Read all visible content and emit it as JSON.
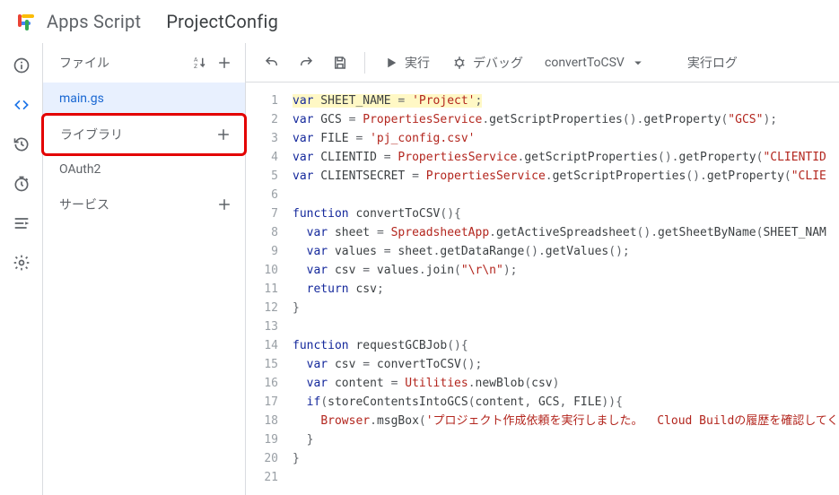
{
  "header": {
    "brand": "Apps Script",
    "project": "ProjectConfig"
  },
  "rail": {
    "items": [
      {
        "id": "overview-icon"
      },
      {
        "id": "editor-icon"
      },
      {
        "id": "history-icon"
      },
      {
        "id": "triggers-icon"
      },
      {
        "id": "executions-icon"
      },
      {
        "id": "settings-icon"
      }
    ]
  },
  "sidebar": {
    "files_label": "ファイル",
    "files": [
      {
        "name": "main.gs"
      }
    ],
    "libraries_label": "ライブラリ",
    "libraries": [
      {
        "name": "OAuth2"
      }
    ],
    "services_label": "サービス"
  },
  "toolbar": {
    "run": "実行",
    "debug": "デバッグ",
    "fn_selected": "convertToCSV",
    "log": "実行ログ"
  },
  "code": {
    "tokens": [
      [
        [
          "k",
          "var"
        ],
        [
          "pn",
          " SHEET_NAME "
        ],
        [
          "p",
          "="
        ],
        [
          "pn",
          " "
        ],
        [
          "s",
          "'Project'"
        ],
        [
          "p",
          ";"
        ]
      ],
      [
        [
          "k",
          "var"
        ],
        [
          "pn",
          " GCS "
        ],
        [
          "p",
          "="
        ],
        [
          "pn",
          " "
        ],
        [
          "obj",
          "PropertiesService"
        ],
        [
          "p",
          "."
        ],
        [
          "pn",
          "getScriptProperties"
        ],
        [
          "p",
          "()."
        ],
        [
          "pn",
          "getProperty"
        ],
        [
          "p",
          "("
        ],
        [
          "s",
          "\"GCS\""
        ],
        [
          "p",
          ");"
        ]
      ],
      [
        [
          "k",
          "var"
        ],
        [
          "pn",
          " FILE "
        ],
        [
          "p",
          "="
        ],
        [
          "pn",
          " "
        ],
        [
          "s",
          "'pj_config.csv'"
        ]
      ],
      [
        [
          "k",
          "var"
        ],
        [
          "pn",
          " CLIENTID "
        ],
        [
          "p",
          "="
        ],
        [
          "pn",
          " "
        ],
        [
          "obj",
          "PropertiesService"
        ],
        [
          "p",
          "."
        ],
        [
          "pn",
          "getScriptProperties"
        ],
        [
          "p",
          "()."
        ],
        [
          "pn",
          "getProperty"
        ],
        [
          "p",
          "("
        ],
        [
          "s",
          "\"CLIENTID"
        ]
      ],
      [
        [
          "k",
          "var"
        ],
        [
          "pn",
          " CLIENTSECRET "
        ],
        [
          "p",
          "="
        ],
        [
          "pn",
          " "
        ],
        [
          "obj",
          "PropertiesService"
        ],
        [
          "p",
          "."
        ],
        [
          "pn",
          "getScriptProperties"
        ],
        [
          "p",
          "()."
        ],
        [
          "pn",
          "getProperty"
        ],
        [
          "p",
          "("
        ],
        [
          "s",
          "\"CLIE"
        ]
      ],
      [],
      [
        [
          "fnc",
          "function"
        ],
        [
          "pn",
          " convertToCSV"
        ],
        [
          "p",
          "(){"
        ]
      ],
      [
        [
          "pn",
          "  "
        ],
        [
          "k",
          "var"
        ],
        [
          "pn",
          " sheet "
        ],
        [
          "p",
          "="
        ],
        [
          "pn",
          " "
        ],
        [
          "obj",
          "SpreadsheetApp"
        ],
        [
          "p",
          "."
        ],
        [
          "pn",
          "getActiveSpreadsheet"
        ],
        [
          "p",
          "()."
        ],
        [
          "pn",
          "getSheetByName"
        ],
        [
          "p",
          "("
        ],
        [
          "pn",
          "SHEET_NAM"
        ]
      ],
      [
        [
          "pn",
          "  "
        ],
        [
          "k",
          "var"
        ],
        [
          "pn",
          " values "
        ],
        [
          "p",
          "="
        ],
        [
          "pn",
          " sheet"
        ],
        [
          "p",
          "."
        ],
        [
          "pn",
          "getDataRange"
        ],
        [
          "p",
          "()."
        ],
        [
          "pn",
          "getValues"
        ],
        [
          "p",
          "();"
        ]
      ],
      [
        [
          "pn",
          "  "
        ],
        [
          "k",
          "var"
        ],
        [
          "pn",
          " csv "
        ],
        [
          "p",
          "="
        ],
        [
          "pn",
          " values"
        ],
        [
          "p",
          "."
        ],
        [
          "pn",
          "join"
        ],
        [
          "p",
          "("
        ],
        [
          "s",
          "\"\\r\\n\""
        ],
        [
          "p",
          ");"
        ]
      ],
      [
        [
          "pn",
          "  "
        ],
        [
          "k",
          "return"
        ],
        [
          "pn",
          " csv"
        ],
        [
          "p",
          ";"
        ]
      ],
      [
        [
          "p",
          "}"
        ]
      ],
      [],
      [
        [
          "fnc",
          "function"
        ],
        [
          "pn",
          " requestGCBJob"
        ],
        [
          "p",
          "(){"
        ]
      ],
      [
        [
          "pn",
          "  "
        ],
        [
          "k",
          "var"
        ],
        [
          "pn",
          " csv "
        ],
        [
          "p",
          "="
        ],
        [
          "pn",
          " convertToCSV"
        ],
        [
          "p",
          "();"
        ]
      ],
      [
        [
          "pn",
          "  "
        ],
        [
          "k",
          "var"
        ],
        [
          "pn",
          " content "
        ],
        [
          "p",
          "="
        ],
        [
          "pn",
          " "
        ],
        [
          "obj",
          "Utilities"
        ],
        [
          "p",
          "."
        ],
        [
          "pn",
          "newBlob"
        ],
        [
          "p",
          "("
        ],
        [
          "pn",
          "csv"
        ],
        [
          "p",
          ")"
        ]
      ],
      [
        [
          "pn",
          "  "
        ],
        [
          "k",
          "if"
        ],
        [
          "p",
          "("
        ],
        [
          "pn",
          "storeContentsIntoGCS"
        ],
        [
          "p",
          "("
        ],
        [
          "pn",
          "content"
        ],
        [
          "p",
          ", "
        ],
        [
          "pn",
          "GCS"
        ],
        [
          "p",
          ", "
        ],
        [
          "pn",
          "FILE"
        ],
        [
          "p",
          ")){"
        ]
      ],
      [
        [
          "pn",
          "    "
        ],
        [
          "obj",
          "Browser"
        ],
        [
          "p",
          "."
        ],
        [
          "pn",
          "msgBox"
        ],
        [
          "p",
          "("
        ],
        [
          "s",
          "'プロジェクト作成依頼を実行しました。  Cloud Buildの履歴を確認してく"
        ]
      ],
      [
        [
          "pn",
          "  "
        ],
        [
          "p",
          "}"
        ]
      ],
      [
        [
          "p",
          "}"
        ]
      ],
      []
    ]
  }
}
